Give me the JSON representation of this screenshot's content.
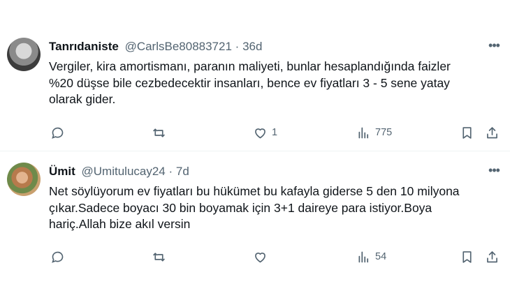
{
  "tweets": [
    {
      "display_name": "Tanrıdaniste",
      "handle": "@CarlsBe80883721",
      "separator": "·",
      "time": "36d",
      "more_label": "•••",
      "text": "Vergiler, kira amortismanı, paranın maliyeti, bunlar hesaplandığında faizler\n%20 düşse bile cezbedecektir insanları, bence ev fiyatları 3 - 5 sene yatay\nolarak gider.",
      "actions": {
        "reply": "",
        "retweet": "",
        "like": "1",
        "views": "775"
      }
    },
    {
      "display_name": "Ümit",
      "handle": "@Umitulucay24",
      "separator": "·",
      "time": "7d",
      "more_label": "•••",
      "text": "Net söylüyorum ev fiyatları bu hükümet bu kafayla giderse 5 den 10 milyona\nçıkar.Sadece boyacı 30 bin boyamak için 3+1 daireye para istiyor.Boya\nhariç.Allah bize akıl versin",
      "actions": {
        "reply": "",
        "retweet": "",
        "like": "",
        "views": "54"
      }
    }
  ],
  "icons": {
    "reply": "reply-icon",
    "retweet": "retweet-icon",
    "like": "heart-icon",
    "views": "views-icon",
    "bookmark": "bookmark-icon",
    "share": "share-icon",
    "more": "more-icon"
  },
  "colors": {
    "text": "#0f1419",
    "secondary": "#536471",
    "divider": "#eff3f4"
  }
}
